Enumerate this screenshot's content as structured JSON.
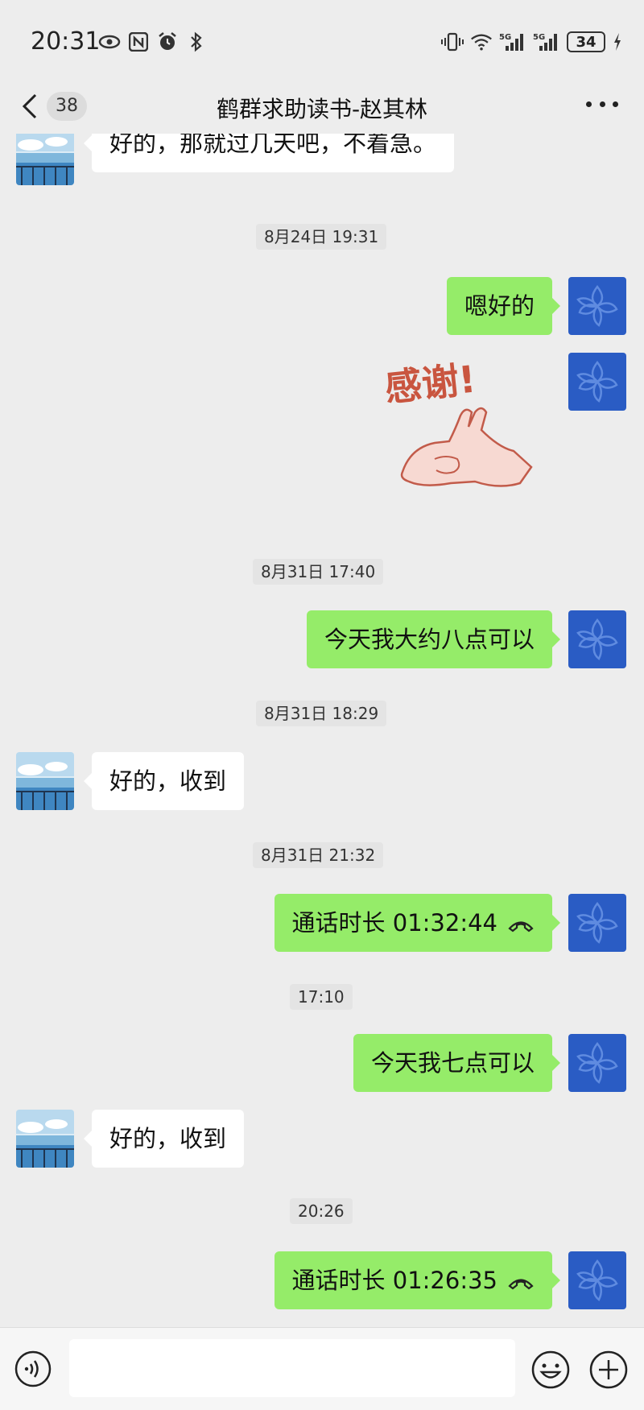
{
  "status_bar": {
    "time": "20:31",
    "battery": "34",
    "left_icons": [
      "eye-icon",
      "nfc-icon",
      "alarm-icon",
      "bluetooth-icon"
    ],
    "right_icons": [
      "vibrate-icon",
      "wifi-icon",
      "signal-5g-icon",
      "signal-5g-icon",
      "battery-icon",
      "charging-icon"
    ],
    "network_label": "5G"
  },
  "header": {
    "unread_count": "38",
    "title": "鹤群求助读书-赵其林"
  },
  "messages": [
    {
      "kind": "text",
      "from": "them",
      "text": "好的，那就过几天吧，不着急。"
    },
    {
      "kind": "timestamp",
      "text": "8月24日 19:31"
    },
    {
      "kind": "text",
      "from": "me",
      "text": "嗯好的"
    },
    {
      "kind": "sticker",
      "from": "me",
      "text": "感谢!"
    },
    {
      "kind": "timestamp",
      "text": "8月31日 17:40"
    },
    {
      "kind": "text",
      "from": "me",
      "text": "今天我大约八点可以"
    },
    {
      "kind": "timestamp",
      "text": "8月31日 18:29"
    },
    {
      "kind": "text",
      "from": "them",
      "text": "好的，收到"
    },
    {
      "kind": "timestamp",
      "text": "8月31日 21:32"
    },
    {
      "kind": "call",
      "from": "me",
      "text": "通话时长 01:32:44"
    },
    {
      "kind": "timestamp",
      "text": "17:10"
    },
    {
      "kind": "text",
      "from": "me",
      "text": "今天我七点可以"
    },
    {
      "kind": "text",
      "from": "them",
      "text": "好的，收到"
    },
    {
      "kind": "timestamp",
      "text": "20:26"
    },
    {
      "kind": "call",
      "from": "me",
      "text": "通话时长 01:26:35"
    }
  ],
  "input_bar": {
    "placeholder": "",
    "icons": [
      "voice-icon",
      "emoji-icon",
      "plus-icon"
    ]
  },
  "colors": {
    "background": "#ededed",
    "outgoing_bubble": "#95ec69",
    "incoming_bubble": "#ffffff",
    "my_avatar": "#2a5cc4",
    "timestamp_bg": "#e4e4e4"
  }
}
